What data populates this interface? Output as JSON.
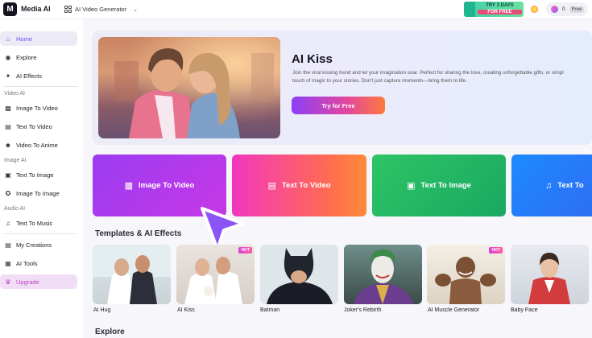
{
  "app": {
    "name": "Media AI",
    "logo_text": "M"
  },
  "tool_selector": {
    "label": "AI Video Generator"
  },
  "promo": {
    "line1": "TRY 3 DAYS",
    "line2": "FOR FREE"
  },
  "credits": {
    "value": "0",
    "plan": "Free"
  },
  "sidebar": {
    "items": [
      {
        "label": "Home",
        "icon": "home-icon"
      },
      {
        "label": "Explore",
        "icon": "compass-icon"
      },
      {
        "label": "AI Effects",
        "icon": "sparkle-icon"
      },
      {
        "label": "Image To Video",
        "icon": "video-icon"
      },
      {
        "label": "Text To Video",
        "icon": "text-video-icon"
      },
      {
        "label": "Video To Anime",
        "icon": "anime-icon"
      },
      {
        "label": "Text To Image",
        "icon": "image-icon"
      },
      {
        "label": "Image To Image",
        "icon": "image-swap-icon"
      },
      {
        "label": "Text To Music",
        "icon": "music-icon"
      },
      {
        "label": "My Creations",
        "icon": "folder-icon"
      },
      {
        "label": "AI Tools",
        "icon": "tools-icon"
      },
      {
        "label": "Upgrade",
        "icon": "crown-icon"
      }
    ],
    "sections": [
      "Video AI",
      "Image AI",
      "Audio AI"
    ]
  },
  "hero": {
    "title": "AI Kiss",
    "desc_line1": "Join the viral kissing trend and let your imagination soar. Perfect for sharing the love, creating unforgettable gifts, or simpl",
    "desc_line2": "touch of magic to your stories. Don't just capture moments—bring them to life.",
    "button": "Try for Free"
  },
  "features": [
    {
      "label": "Image To Video"
    },
    {
      "label": "Text To Video"
    },
    {
      "label": "Text To Image"
    },
    {
      "label": "Text To"
    }
  ],
  "templates_title": "Templates & AI Effects",
  "templates": [
    {
      "label": "AI Hug",
      "hot": ""
    },
    {
      "label": "AI Kiss",
      "hot": "HOT"
    },
    {
      "label": "Batman",
      "hot": ""
    },
    {
      "label": "Joker's Rebirth",
      "hot": ""
    },
    {
      "label": "AI Muscle Generator",
      "hot": "HOT"
    },
    {
      "label": "Baby Face",
      "hot": ""
    }
  ],
  "explore_title": "Explore",
  "colors": {
    "accent": "#6a4cff",
    "upgrade": "#c03ec9"
  }
}
